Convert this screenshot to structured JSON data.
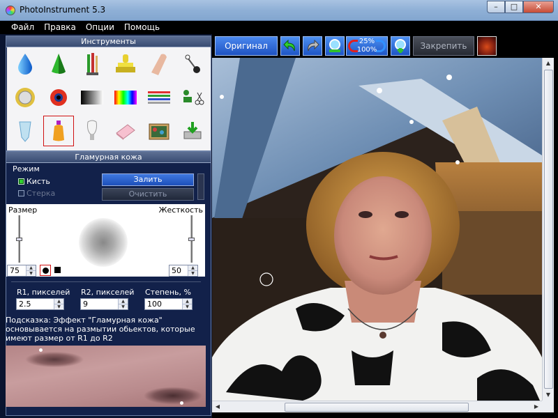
{
  "window": {
    "title": "PhotoInstrument 5.3",
    "buttons": {
      "minimize": "–",
      "maximize": "□",
      "close": "✕"
    }
  },
  "menu": {
    "items": [
      "Файл",
      "Правка",
      "Опции",
      "Помощь"
    ]
  },
  "tools_panel": {
    "title": "Инструменты",
    "tools": [
      {
        "name": "drop-icon"
      },
      {
        "name": "cone-icon"
      },
      {
        "name": "brushes-icon"
      },
      {
        "name": "stamp-icon"
      },
      {
        "name": "finger-icon"
      },
      {
        "name": "pin-icon"
      },
      {
        "name": "sun-shield-icon"
      },
      {
        "name": "eye-icon"
      },
      {
        "name": "gradient-icon"
      },
      {
        "name": "spectrum-icon"
      },
      {
        "name": "lines-icon"
      },
      {
        "name": "scissors-icon"
      },
      {
        "name": "tube-icon"
      },
      {
        "name": "bottle-icon",
        "selected": true
      },
      {
        "name": "bulb-icon"
      },
      {
        "name": "eraser-icon"
      },
      {
        "name": "tv-icon"
      },
      {
        "name": "save-icon"
      }
    ]
  },
  "glam_panel": {
    "title": "Гламурная кожа",
    "mode_label": "Режим",
    "brush_label": "Кисть",
    "brush_checked": true,
    "eraser_label": "Стерка",
    "eraser_checked": false,
    "fill_button": "Залить",
    "clear_button": "Очистить",
    "size_label": "Размер",
    "hardness_label": "Жесткость",
    "size_value": "75",
    "hardness_value": "50",
    "r1_label": "R1, пикселей",
    "r2_label": "R2, пикселей",
    "degree_label": "Степень, %",
    "r1_value": "2.5",
    "r2_value": "9",
    "degree_value": "100",
    "hint": "Подсказка: Эффект \"Гламурная кожа\" основывается на размытии обьектов, которые имеют размер от R1 до R2"
  },
  "toolbar": {
    "original_button": "Оригинал",
    "zoom_top": "25%",
    "zoom_bottom": "100%",
    "fix_button": "Закрепить"
  },
  "colors": {
    "panel_bg": "#0a1430",
    "accent_blue": "#1e55c6",
    "selected_outline": "#d01010"
  }
}
